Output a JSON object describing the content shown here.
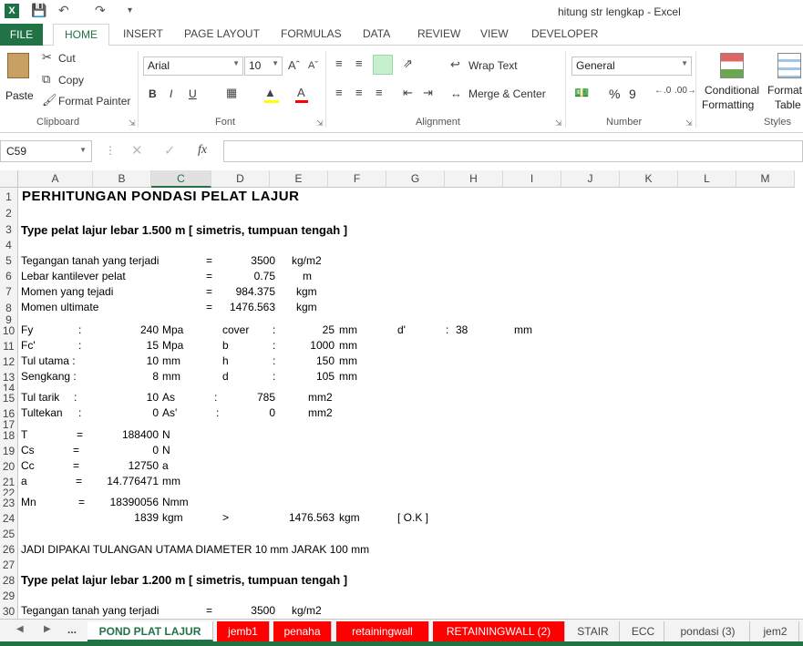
{
  "window": {
    "title": "hitung str lengkap - Excel"
  },
  "ribbon_tabs": [
    "FILE",
    "HOME",
    "INSERT",
    "PAGE LAYOUT",
    "FORMULAS",
    "DATA",
    "REVIEW",
    "VIEW",
    "DEVELOPER"
  ],
  "clipboard": {
    "paste": "Paste",
    "cut": "Cut",
    "copy": "Copy",
    "format_painter": "Format Painter",
    "label": "Clipboard"
  },
  "font": {
    "name": "Arial",
    "size": "10",
    "label": "Font",
    "bold": "B",
    "italic": "I",
    "underline": "U"
  },
  "alignment": {
    "wrap": "Wrap Text",
    "merge": "Merge & Center",
    "label": "Alignment"
  },
  "number": {
    "format": "General",
    "percent": "%",
    "comma": "9",
    "label": "Number"
  },
  "styles": {
    "cond1": "Conditional",
    "cond2": "Formatting",
    "fmt1": "Format",
    "fmt2": "Table",
    "label": "Styles"
  },
  "name_box": "C59",
  "fx_label": "fx",
  "columns": [
    "A",
    "B",
    "C",
    "D",
    "E",
    "F",
    "G",
    "H",
    "I",
    "J",
    "K",
    "L",
    "M"
  ],
  "rows": [
    "1",
    "2",
    "3",
    "4",
    "5",
    "6",
    "7",
    "8",
    "9",
    "10",
    "11",
    "12",
    "13",
    "14",
    "15",
    "16",
    "17",
    "18",
    "19",
    "20",
    "21",
    "22",
    "23",
    "24",
    "25",
    "26",
    "27",
    "28",
    "29",
    "30"
  ],
  "cells": {
    "r1": "PERHITUNGAN  PONDASI  PELAT  LAJUR",
    "r3": "Type pelat lajur lebar 1.500 m [ simetris, tumpuan tengah ]",
    "r5a": "Tegangan tanah yang terjadi",
    "r5eq": "=",
    "r5v": "3500",
    "r5u": "kg/m2",
    "r6a": "Lebar kantilever pelat",
    "r6eq": "=",
    "r6v": "0.75",
    "r6u": "m",
    "r7a": "Momen yang tejadi",
    "r7eq": "=",
    "r7v": "984.375",
    "r7u": "kgm",
    "r8a": "Momen ultimate",
    "r8eq": "=",
    "r8v": "1476.563",
    "r8u": "kgm",
    "r10a": "Fy",
    "r10c": ":",
    "r10v": "240",
    "r10u": "Mpa",
    "r10d": "cover",
    "r10dc": ":",
    "r10e": "25",
    "r10eu": "mm",
    "r10g": "d'",
    "r10gc": ":",
    "r10h": "38",
    "r10hu": "mm",
    "r11a": "Fc'",
    "r11c": ":",
    "r11v": "15",
    "r11u": "Mpa",
    "r11d": "b",
    "r11dc": ":",
    "r11e": "1000",
    "r11eu": "mm",
    "r12a": "Tul utama :",
    "r12v": "10",
    "r12u": "mm",
    "r12d": "h",
    "r12dc": ":",
    "r12e": "150",
    "r12eu": "mm",
    "r13a": "Sengkang :",
    "r13v": "8",
    "r13u": "mm",
    "r13d": "d",
    "r13dc": ":",
    "r13e": "105",
    "r13eu": "mm",
    "r15a": "Tul tarik",
    "r15c": ":",
    "r15v": "10",
    "r15u": "As",
    "r15dc": ":",
    "r15e": "785",
    "r15eu": "mm2",
    "r16a": "Tultekan",
    "r16c": ":",
    "r16v": "0",
    "r16u": "As'",
    "r16dc": ":",
    "r16e": "0",
    "r16eu": "mm2",
    "r18a": "T",
    "r18eq": "=",
    "r18v": "188400",
    "r18u": "N",
    "r19a": "Cs",
    "r19eq": "=",
    "r19v": "0",
    "r19u": "N",
    "r20a": "Cc",
    "r20eq": "=",
    "r20v": "12750",
    "r20u": "a",
    "r21a": "a",
    "r21eq": "=",
    "r21v": "14.776471",
    "r21u": "mm",
    "r23a": "Mn",
    "r23eq": "=",
    "r23v": "18390056",
    "r23u": "Nmm",
    "r24v": "1839",
    "r24u": "kgm",
    "r24gt": ">",
    "r24e": "1476.563",
    "r24eu": "kgm",
    "r24ok": "[ O.K ]",
    "r26": "JADI DIPAKAI TULANGAN UTAMA DIAMETER 10 mm JARAK 100 mm",
    "r28": "Type pelat lajur lebar 1.200 m [ simetris, tumpuan tengah ]",
    "r30a": "Tegangan tanah yang terjadi",
    "r30eq": "=",
    "r30v": "3500",
    "r30u": "kg/m2"
  },
  "sheet_nav": "...",
  "sheets": [
    "POND PLAT LAJUR",
    "jemb1",
    "penaha",
    "retainingwall",
    "RETAININGWALL (2)",
    "STAIR",
    "ECC",
    "pondasi (3)",
    "jem2"
  ]
}
